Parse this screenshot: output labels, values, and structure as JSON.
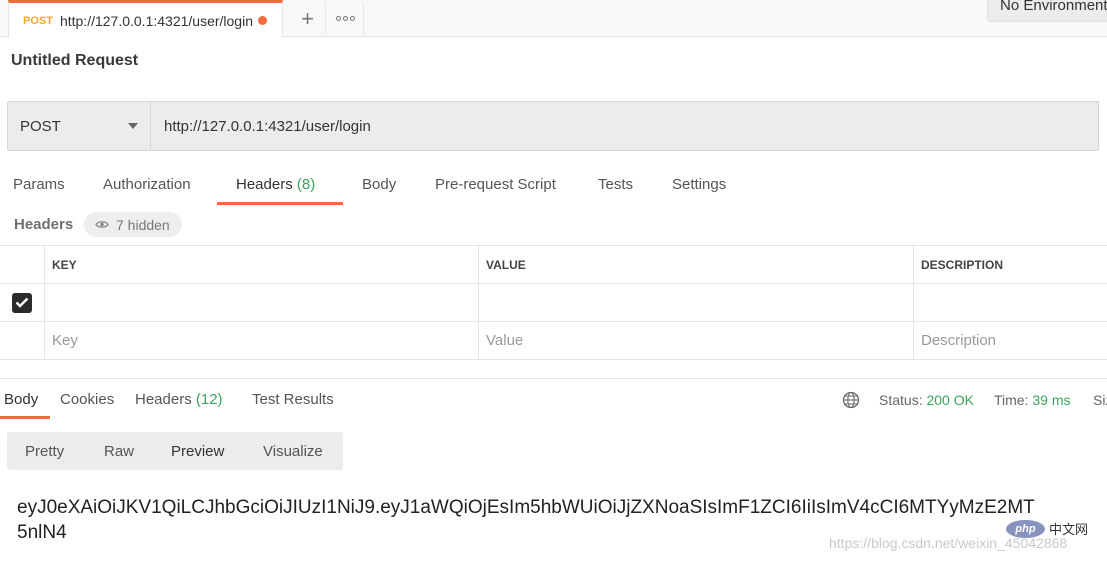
{
  "tabbar": {
    "active_tab": {
      "method": "POST",
      "url": "http://127.0.0.1:4321/user/login",
      "unsaved": true
    },
    "add_tab_label": "+",
    "environment": "No Environment"
  },
  "request": {
    "title": "Untitled Request",
    "method": "POST",
    "url": "http://127.0.0.1:4321/user/login"
  },
  "request_tabs": [
    {
      "label": "Params",
      "count": ""
    },
    {
      "label": "Authorization",
      "count": ""
    },
    {
      "label": "Headers",
      "count": "(8)"
    },
    {
      "label": "Body",
      "count": ""
    },
    {
      "label": "Pre-request Script",
      "count": ""
    },
    {
      "label": "Tests",
      "count": ""
    },
    {
      "label": "Settings",
      "count": ""
    }
  ],
  "active_request_tab": "Headers",
  "headers_section": {
    "label": "Headers",
    "hidden_label": "7 hidden",
    "columns": {
      "key": "KEY",
      "value": "VALUE",
      "description": "DESCRIPTION"
    },
    "rows": [
      {
        "checked": true,
        "key": "",
        "value": "",
        "description": ""
      }
    ],
    "placeholders": {
      "key": "Key",
      "value": "Value",
      "description": "Description"
    }
  },
  "response": {
    "tabs": [
      {
        "label": "Body",
        "count": ""
      },
      {
        "label": "Cookies",
        "count": ""
      },
      {
        "label": "Headers",
        "count": "(12)"
      },
      {
        "label": "Test Results",
        "count": ""
      }
    ],
    "active_tab": "Body",
    "status_label": "Status:",
    "status_value": "200 OK",
    "time_label": "Time:",
    "time_value": "39 ms",
    "size_label": "Siz",
    "view_tabs": [
      "Pretty",
      "Raw",
      "Preview",
      "Visualize"
    ],
    "active_view": "Preview",
    "body_lines": [
      "eyJ0eXAiOiJKV1QiLCJhbGciOiJIUzI1NiJ9.eyJ1aWQiOjEsIm5hbWUiOiJjZXNoaSIsImF1ZCI6IiIsImV4cCI6MTYyMzE2MT",
      "5nlN4"
    ]
  },
  "overlay": {
    "php_logo": "php",
    "php_text": "中文网",
    "watermark": "https://blog.csdn.net/weixin_45042868"
  },
  "colors": {
    "accent": "#f26b3a",
    "method_post": "#f7a534",
    "success": "#3da35d"
  }
}
